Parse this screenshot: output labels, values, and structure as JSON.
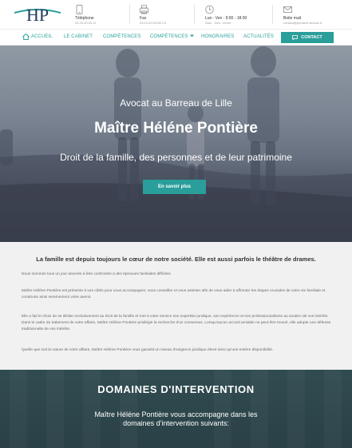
{
  "header": {
    "logo_text": "HP",
    "phone": {
      "label": "Téléphone",
      "value": "03.20.00.00.11"
    },
    "fax": {
      "label": "Fax",
      "value": "03.20.00.00.88 Ch"
    },
    "hours": {
      "label": "Lun - Ven : 9:00 - 18:00",
      "value": "Sam - Dim : fermé"
    },
    "mail": {
      "label": "Boite mail",
      "value": "contact@pontiere-avocat.fr"
    }
  },
  "nav": {
    "items": [
      "ACCUEIL",
      "LE CABINET",
      "COMPÉTENCES",
      "COMPÉTENCES",
      "HONORAIRES",
      "ACTUALITÉS"
    ],
    "contact_label": "CONTACT"
  },
  "hero": {
    "pretitle": "Avocat au Barreau de Lille",
    "title": "Maître Héléne Pontière",
    "subtitle": "Droit de la famille, des personnes et de leur patrimoine",
    "cta_label": "En savoir plus"
  },
  "intro": {
    "heading": "La famille est depuis toujours le cœur de notre société. Elle est aussi parfois le théâtre de drames.",
    "paragraphs": [
      "Nous sommes tous un jour amenés à être confrontés à des épreuves familiales difficiles.",
      "Maître Héléne Pontière est présente à vos côtés pour vous accompagner, vous conseiller et vous assister afin de vous aider à affronter les étapes cruciales de votre vie familiale et construire ainsi sereinement votre avenir.",
      "Elle a fait le choix de se dédier exclusivement au droit de la famille et met à votre service son expertise juridique, son expérience et son professionnalisme au soutien de vos intérêts. Dans le cadre du traitement de votre affaire, Maître Héléne Pontière privilégie la recherche d'un consensus. Lorsqu'aucun accord amiable ne peut être trouvé, elle adopte une défense traditionnelle de vos intérêts.",
      "Quelle que soit la nature de votre affaire, Maître Héléne Pontière vous garantit un niveau d'exigence juridique élevé ainsi qu'une entière disponibilité."
    ]
  },
  "domains": {
    "title": "DOMAINES D'INTERVENTION",
    "subtitle": "Maître Héléne Pontière vous accompagne dans les domaines d'intervention suivants:"
  },
  "colors": {
    "accent": "#2a9e9b",
    "nav_text": "#2aa39d",
    "logo_navy": "#1f3b5c",
    "logo_teal": "#2a9e9b",
    "intro_bg": "#f1f1f1",
    "domains_bg": "#3a5257"
  },
  "icons": {
    "phone": "phone-icon",
    "fax": "fax-icon",
    "hours": "clock-icon",
    "mail": "envelope-icon",
    "home": "home-icon",
    "contact": "chat-icon",
    "dropdown": "caret-down-icon"
  }
}
